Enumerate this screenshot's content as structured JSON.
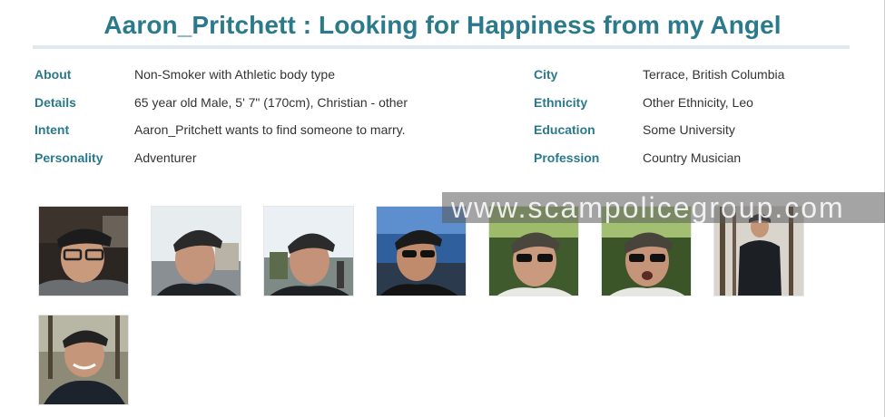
{
  "header": {
    "title": "Aaron_Pritchett : Looking for Happiness from my Angel"
  },
  "profile_left": [
    {
      "label": "About",
      "value": "Non-Smoker with Athletic body type"
    },
    {
      "label": "Details",
      "value": "65 year old Male, 5' 7\" (170cm), Christian - other"
    },
    {
      "label": "Intent",
      "value": "Aaron_Pritchett wants to find someone to marry."
    },
    {
      "label": "Personality",
      "value": "Adventurer"
    }
  ],
  "profile_right": [
    {
      "label": "City",
      "value": "Terrace, British Columbia"
    },
    {
      "label": "Ethnicity",
      "value": "Other Ethnicity, Leo"
    },
    {
      "label": "Education",
      "value": "Some University"
    },
    {
      "label": "Profession",
      "value": "Country Musician"
    }
  ],
  "watermark": {
    "text": "www.scampolicegroup.com"
  },
  "photos": [
    {
      "name": "photo-1",
      "icon": "man-in-car-selfie"
    },
    {
      "name": "photo-2",
      "icon": "man-cap-selfie-outdoor"
    },
    {
      "name": "photo-3",
      "icon": "man-cap-selfie-street"
    },
    {
      "name": "photo-4",
      "icon": "man-sunglasses-waterfront"
    },
    {
      "name": "photo-5",
      "icon": "man-sunglasses-trees"
    },
    {
      "name": "photo-6",
      "icon": "man-sunglasses-trees-2"
    },
    {
      "name": "photo-7",
      "icon": "man-jacket-forest"
    },
    {
      "name": "photo-8",
      "icon": "man-smiling-forest"
    }
  ],
  "colors": {
    "accent": "#2a7a8c",
    "text": "#333333",
    "rule": "#dfe9ef"
  }
}
